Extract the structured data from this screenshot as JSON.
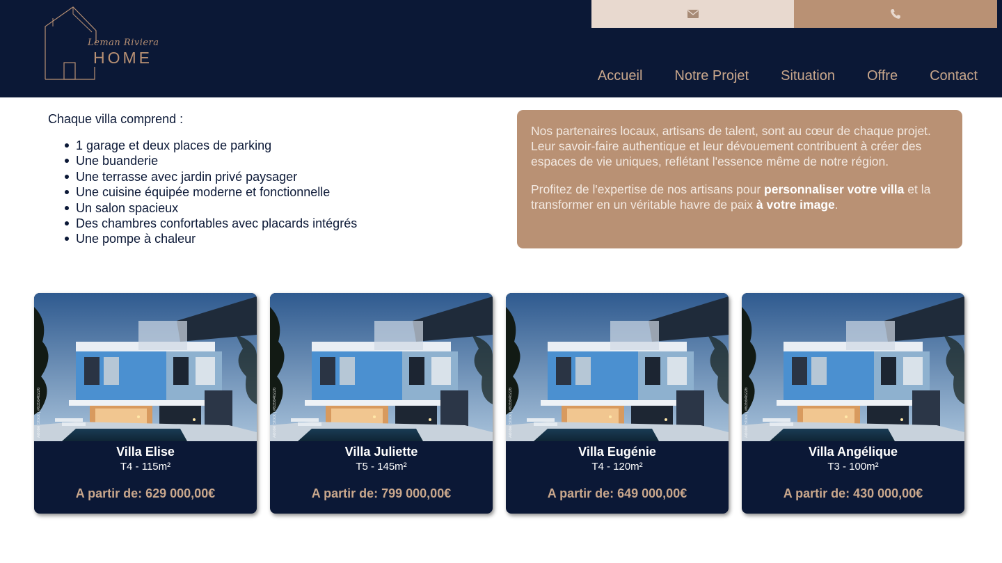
{
  "header": {
    "logo_script": "Leman Riviera",
    "logo_main": "HOME",
    "contact": {
      "mail_icon": "envelope-icon",
      "phone_icon": "phone-icon"
    },
    "nav": [
      "Accueil",
      "Notre Projet",
      "Situation",
      "Offre",
      "Contact"
    ]
  },
  "features": {
    "title": "Chaque villa comprend :",
    "items": [
      "1 garage et deux places de parking",
      "Une buanderie",
      "Une terrasse avec jardin privé paysager",
      "Une cuisine équipée moderne et fonctionnelle",
      "Un salon spacieux",
      "Des chambres confortables avec placards intégrés",
      "Une pompe à chaleur"
    ]
  },
  "partners": {
    "p1": "Nos partenaires locaux, artisans de talent, sont au cœur de chaque projet. Leur savoir-faire authentique et leur dévouement contribuent à créer des espaces de vie uniques, reflétant l'essence même de notre région.",
    "p2_a": "Profitez de l'expertise de nos artisans pour ",
    "p2_b": "personnaliser votre villa",
    "p2_c": " et la transformer en un véritable havre de paix ",
    "p2_d": "à votre image",
    "p2_e": "."
  },
  "villas": [
    {
      "name": "Villa Elise",
      "spec": "T4 - 115m²",
      "price": "A partir de: 629 000,00€"
    },
    {
      "name": "Villa Juliette",
      "spec": "T5 - 145m²",
      "price": "A partir de: 799 000,00€"
    },
    {
      "name": "Villa Eugénie",
      "spec": "T4 - 120m²",
      "price": "A partir de: 649 000,00€"
    },
    {
      "name": "Villa Angélique",
      "spec": "T3 - 100m²",
      "price": "A partir de: 430 000,00€"
    }
  ],
  "image_watermark": "Adobe Stock | #635648226",
  "colors": {
    "navy": "#0b1836",
    "tan": "#b99174",
    "light_tan": "#e8d9cf",
    "nav_text": "#c9a78c"
  }
}
